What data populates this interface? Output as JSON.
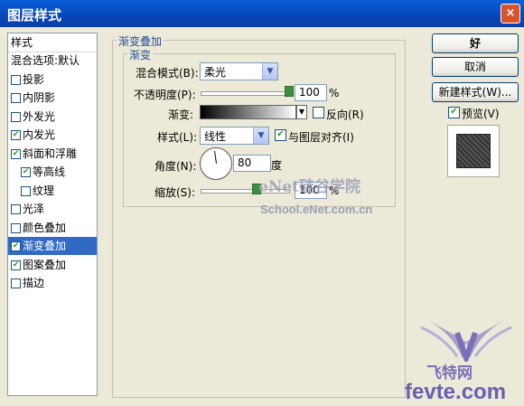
{
  "window": {
    "title": "图层样式",
    "close": "×"
  },
  "style_list": {
    "header": "样式",
    "items": [
      {
        "label": "混合选项:默认",
        "check": false,
        "has_cb": false,
        "sel": false
      },
      {
        "label": "投影",
        "check": false,
        "has_cb": true,
        "sel": false
      },
      {
        "label": "内阴影",
        "check": false,
        "has_cb": true,
        "sel": false
      },
      {
        "label": "外发光",
        "check": false,
        "has_cb": true,
        "sel": false
      },
      {
        "label": "内发光",
        "check": true,
        "has_cb": true,
        "sel": false
      },
      {
        "label": "斜面和浮雕",
        "check": true,
        "has_cb": true,
        "sel": false
      },
      {
        "label": "等高线",
        "check": true,
        "has_cb": true,
        "sel": false,
        "sub": true
      },
      {
        "label": "纹理",
        "check": false,
        "has_cb": true,
        "sel": false,
        "sub": true
      },
      {
        "label": "光泽",
        "check": false,
        "has_cb": true,
        "sel": false
      },
      {
        "label": "颜色叠加",
        "check": false,
        "has_cb": true,
        "sel": false
      },
      {
        "label": "渐变叠加",
        "check": true,
        "has_cb": true,
        "sel": true
      },
      {
        "label": "图案叠加",
        "check": true,
        "has_cb": true,
        "sel": false
      },
      {
        "label": "描边",
        "check": false,
        "has_cb": true,
        "sel": false
      }
    ]
  },
  "panel": {
    "group_title": "渐变叠加",
    "subgroup_title": "渐变",
    "blend_mode_label": "混合模式(B):",
    "blend_mode_value": "柔光",
    "opacity_label": "不透明度(P):",
    "opacity_value": "100",
    "opacity_unit": "%",
    "gradient_label": "渐变:",
    "reverse_label": "反向(R)",
    "reverse_checked": false,
    "style_label": "样式(L):",
    "style_value": "线性",
    "align_label": "与图层对齐(I)",
    "align_checked": true,
    "angle_label": "角度(N):",
    "angle_value": "80",
    "angle_unit": "度",
    "scale_label": "缩放(S):",
    "scale_value": "100",
    "scale_unit": "%"
  },
  "buttons": {
    "ok": "好",
    "cancel": "取消",
    "new_style": "新建样式(W)...",
    "preview_label": "预览(V)",
    "preview_checked": true
  },
  "watermarks": {
    "site_logo": "eNet硅谷学院",
    "site_url": "School.eNet.com.cn",
    "brand_logo": "飞特网",
    "brand_url": "fevte.com"
  },
  "checkmark_glyph": "✔",
  "colors": {
    "selection": "#316ac5",
    "titlebar": "#0a5fd8",
    "dialog": "#ece9d8"
  }
}
